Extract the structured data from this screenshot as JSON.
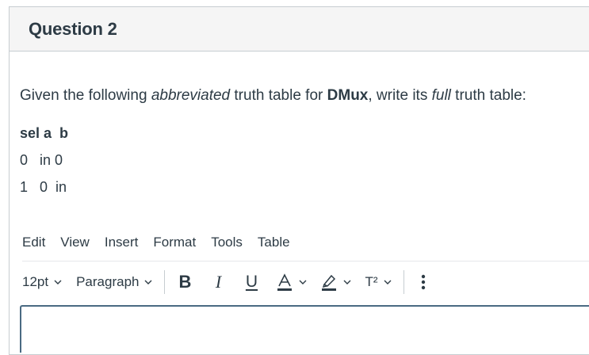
{
  "question": {
    "title": "Question 2",
    "prompt": {
      "part1": "Given the following ",
      "part2": "abbreviated",
      "part3": " truth table for ",
      "part4": "DMux",
      "part5": ", write its ",
      "part6": "full",
      "part7": " truth table:"
    },
    "truth_table": {
      "header": "sel a  b",
      "rows": [
        "0   in 0",
        "1   0  in"
      ]
    }
  },
  "editor": {
    "menu": [
      "Edit",
      "View",
      "Insert",
      "Format",
      "Tools",
      "Table"
    ],
    "toolbar": {
      "font_size": "12pt",
      "block_format": "Paragraph",
      "superscript_label": "T²"
    },
    "icons": [
      "chevron-down-icon",
      "bold-icon",
      "italic-icon",
      "underline-icon",
      "text-color-icon",
      "highlight-icon",
      "superscript-icon",
      "more-icon"
    ],
    "colors": {
      "border": "#4a6a82",
      "text": "#2d3b45",
      "header_bg": "#f5f5f5"
    }
  }
}
